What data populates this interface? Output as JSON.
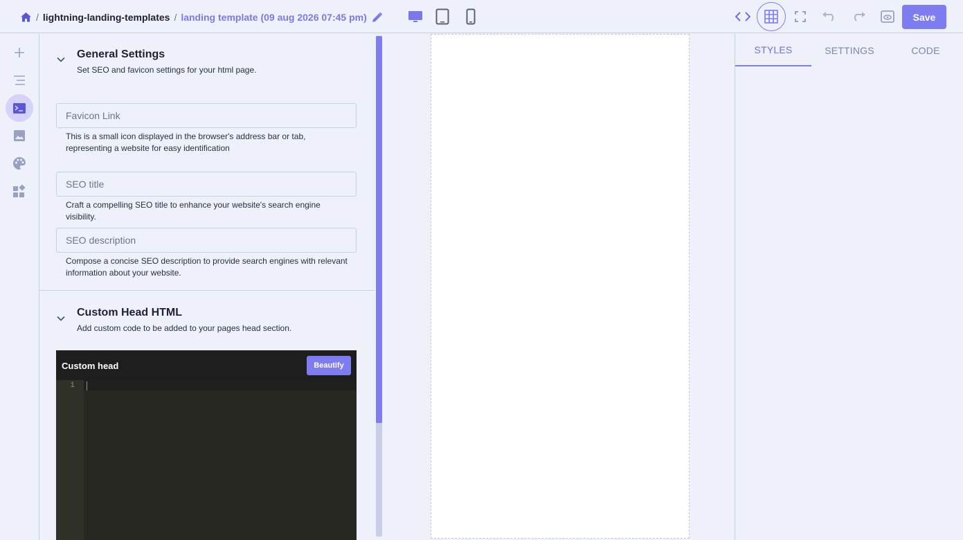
{
  "header": {
    "breadcrumb": {
      "separator": "/",
      "project": "lightning-landing-templates",
      "page": "landing template (09 aug 2026 07:45 pm)"
    },
    "save_label": "Save",
    "icons": [
      "home-icon",
      "edit-icon",
      "desktop-icon",
      "tablet-icon",
      "mobile-icon",
      "code-icon",
      "grid-icon",
      "fullscreen-icon",
      "undo-icon",
      "redo-icon",
      "preview-icon"
    ]
  },
  "rail": {
    "items": [
      "add-icon",
      "layers-icon",
      "page-settings-icon",
      "media-icon",
      "theme-icon",
      "blocks-icon"
    ],
    "active": "page-settings-icon"
  },
  "general": {
    "title": "General Settings",
    "subtitle": "Set SEO and favicon settings for your html page.",
    "favicon": {
      "placeholder": "Favicon Link",
      "value": "",
      "help": "This is a small icon displayed in the browser's address bar or tab, representing a website for easy identification"
    },
    "seo_title": {
      "placeholder": "SEO title",
      "value": "",
      "help": "Craft a compelling SEO title to enhance your website's search engine visibility."
    },
    "seo_description": {
      "placeholder": "SEO description",
      "value": "",
      "help": "Compose a concise SEO description to provide search engines with relevant information about your website."
    }
  },
  "custom_head": {
    "title": "Custom Head HTML",
    "subtitle": "Add custom code to be added to your pages head section.",
    "editor_title": "Custom head",
    "beautify_label": "Beautify",
    "line_number": "1"
  },
  "right_panel": {
    "tabs": [
      {
        "label": "STYLES",
        "active": true
      },
      {
        "label": "SETTINGS",
        "active": false
      },
      {
        "label": "CODE",
        "active": false
      }
    ]
  },
  "colors": {
    "accent": "#7d7cf0",
    "background": "#eef1fa",
    "border": "#c9cde0",
    "editor_bg": "#272822"
  }
}
